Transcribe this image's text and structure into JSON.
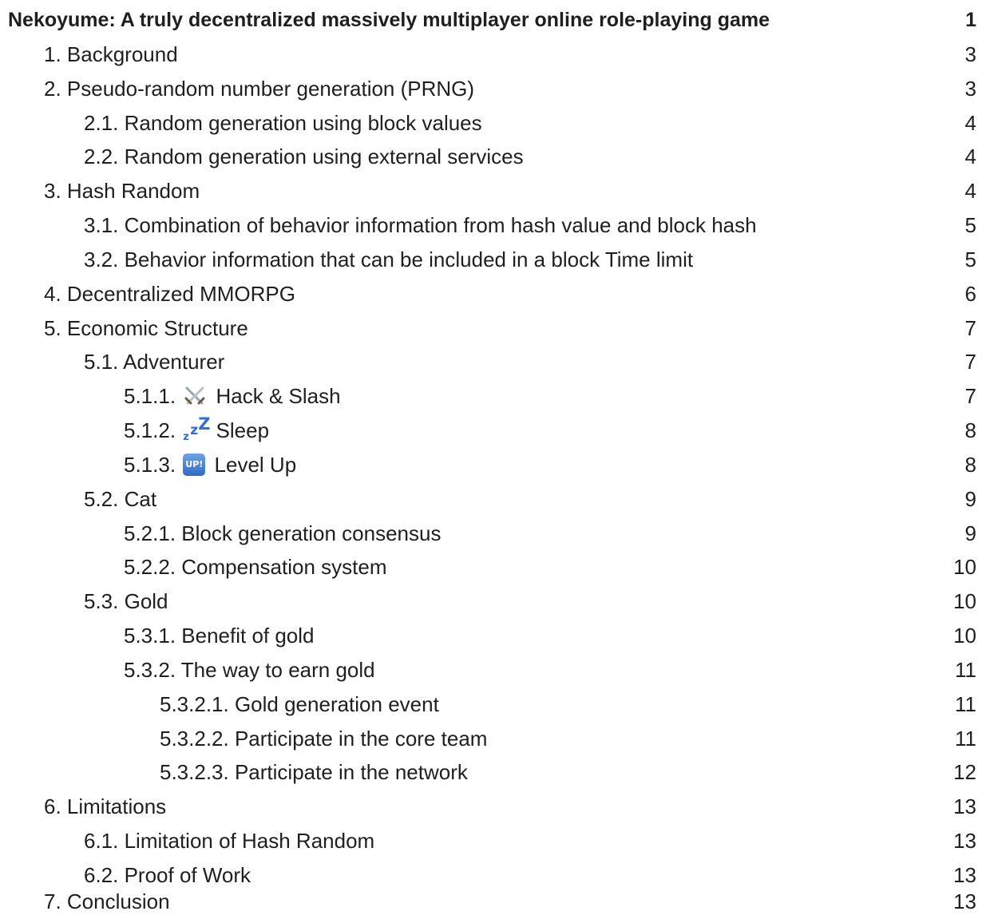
{
  "toc": [
    {
      "label": "Nekoyume: A truly decentralized massively multiplayer online role-playing game",
      "page": "1",
      "level": 0,
      "title": true
    },
    {
      "label": "1. Background",
      "page": "3",
      "level": 1
    },
    {
      "label": "2. Pseudo-random number generation (PRNG)",
      "page": "3",
      "level": 1
    },
    {
      "label": "2.1. Random generation using block values",
      "page": "4",
      "level": 2
    },
    {
      "label": "2.2. Random generation using external services",
      "page": "4",
      "level": 2
    },
    {
      "label": "3. Hash Random",
      "page": "4",
      "level": 1
    },
    {
      "label": "3.1. Combination of behavior information from hash value and block hash",
      "page": "5",
      "level": 2
    },
    {
      "label": "3.2. Behavior information that can be included in a block Time limit",
      "page": "5",
      "level": 2
    },
    {
      "label": "4. Decentralized MMORPG",
      "page": "6",
      "level": 1
    },
    {
      "label": "5. Economic Structure",
      "page": "7",
      "level": 1
    },
    {
      "label": "5.1. Adventurer",
      "page": "7",
      "level": 2
    },
    {
      "label": "5.1.1.",
      "text": "Hack & Slash",
      "icon": "crossed-swords-icon",
      "page": "7",
      "level": 3
    },
    {
      "label": "5.1.2.",
      "text": "Sleep",
      "icon": "zzz-sleep-icon",
      "page": "8",
      "level": 3
    },
    {
      "label": "5.1.3.",
      "text": "Level Up",
      "icon": "up-badge-icon",
      "icon_text": "UP!",
      "page": "8",
      "level": 3
    },
    {
      "label": "5.2. Cat",
      "page": "9",
      "level": 2
    },
    {
      "label": "5.2.1. Block generation consensus",
      "page": "9",
      "level": 3
    },
    {
      "label": "5.2.2. Compensation system",
      "page": "10",
      "level": 3
    },
    {
      "label": "5.3. Gold",
      "page": "10",
      "level": 2
    },
    {
      "label": "5.3.1. Benefit of gold",
      "page": "10",
      "level": 3
    },
    {
      "label": "5.3.2. The way to earn gold",
      "page": "11",
      "level": 3
    },
    {
      "label": "5.3.2.1. Gold generation event",
      "page": "11",
      "level": 4
    },
    {
      "label": "5.3.2.2. Participate in the core team",
      "page": "11",
      "level": 4
    },
    {
      "label": "5.3.2.3. Participate in the network",
      "page": "12",
      "level": 4
    },
    {
      "label": "6. Limitations",
      "page": "13",
      "level": 1
    },
    {
      "label": "6.1. Limitation of Hash Random",
      "page": "13",
      "level": 2
    },
    {
      "label": "6.2. Proof of Work",
      "page": "13",
      "level": 2
    },
    {
      "label": "7. Conclusion",
      "page": "13",
      "level": 1
    }
  ],
  "colors": {
    "text": "#1f1f1f",
    "zzz_blue": "#2f6fd6",
    "up_badge": "#2f6bc4"
  }
}
